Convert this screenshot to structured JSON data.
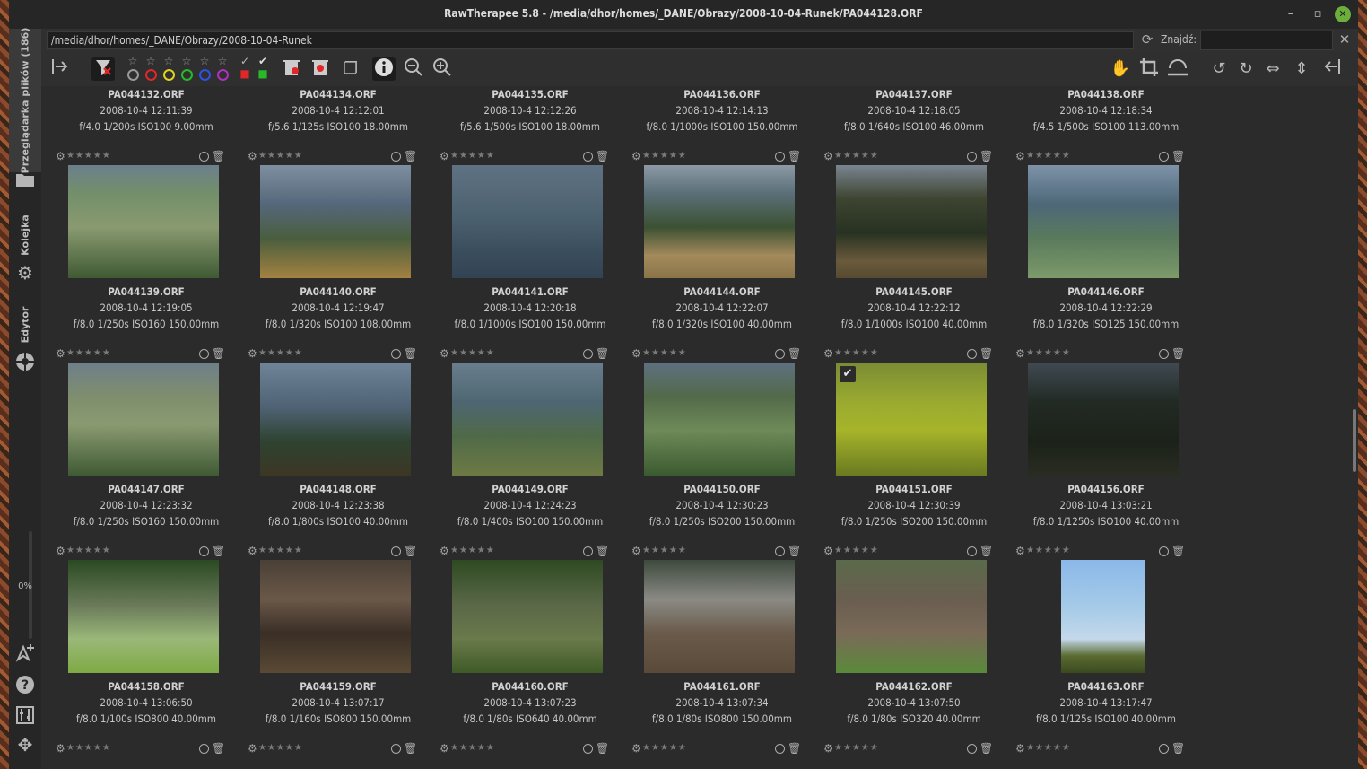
{
  "window": {
    "title": "RawTherapee 5.8 - /media/dhor/homes/_DANE/Obrazy/2008-10-04-Runek/PA044128.ORF"
  },
  "sidebar": {
    "tabs": [
      {
        "label": "Przeglądarka plików (186)"
      },
      {
        "label": "Kolejka"
      },
      {
        "label": "Edytor"
      }
    ],
    "progress": "0%"
  },
  "pathbar": {
    "path": "/media/dhor/homes/_DANE/Obrazy/2008-10-04-Runek",
    "find_label": "Znajdź:",
    "find_value": ""
  },
  "toolbar": {
    "zoom_hint": "",
    "colors": {
      "red": "#e02828",
      "yellow": "#e0d020",
      "green": "#28b828",
      "blue": "#3050e0",
      "purple": "#b030c0"
    }
  },
  "rows": [
    {
      "items": [
        {
          "name": "PA044132.ORF",
          "date": "2008-10-4 12:11:39",
          "exif": "f/4.0 1/200s ISO100 9.00mm"
        },
        {
          "name": "PA044134.ORF",
          "date": "2008-10-4 12:12:01",
          "exif": "f/5.6 1/125s ISO100 18.00mm"
        },
        {
          "name": "PA044135.ORF",
          "date": "2008-10-4 12:12:26",
          "exif": "f/5.6 1/500s ISO100 18.00mm"
        },
        {
          "name": "PA044136.ORF",
          "date": "2008-10-4 12:14:13",
          "exif": "f/8.0 1/1000s ISO100 150.00mm"
        },
        {
          "name": "PA044137.ORF",
          "date": "2008-10-4 12:18:05",
          "exif": "f/8.0 1/640s ISO100 46.00mm"
        },
        {
          "name": "PA044138.ORF",
          "date": "2008-10-4 12:18:34",
          "exif": "f/4.5 1/500s ISO100 113.00mm"
        }
      ]
    },
    {
      "items": [
        {
          "name": "PA044139.ORF",
          "date": "2008-10-4 12:19:05",
          "exif": "f/8.0 1/250s ISO160 150.00mm"
        },
        {
          "name": "PA044140.ORF",
          "date": "2008-10-4 12:19:47",
          "exif": "f/8.0 1/320s ISO100 108.00mm"
        },
        {
          "name": "PA044141.ORF",
          "date": "2008-10-4 12:20:18",
          "exif": "f/8.0 1/1000s ISO100 150.00mm"
        },
        {
          "name": "PA044144.ORF",
          "date": "2008-10-4 12:22:07",
          "exif": "f/8.0 1/320s ISO100 40.00mm"
        },
        {
          "name": "PA044145.ORF",
          "date": "2008-10-4 12:22:12",
          "exif": "f/8.0 1/1000s ISO100 40.00mm"
        },
        {
          "name": "PA044146.ORF",
          "date": "2008-10-4 12:22:29",
          "exif": "f/8.0 1/320s ISO125 150.00mm"
        }
      ]
    },
    {
      "items": [
        {
          "name": "PA044147.ORF",
          "date": "2008-10-4 12:23:32",
          "exif": "f/8.0 1/250s ISO160 150.00mm"
        },
        {
          "name": "PA044148.ORF",
          "date": "2008-10-4 12:23:38",
          "exif": "f/8.0 1/800s ISO100 40.00mm"
        },
        {
          "name": "PA044149.ORF",
          "date": "2008-10-4 12:24:23",
          "exif": "f/8.0 1/400s ISO100 150.00mm"
        },
        {
          "name": "PA044150.ORF",
          "date": "2008-10-4 12:30:23",
          "exif": "f/8.0 1/250s ISO200 150.00mm"
        },
        {
          "name": "PA044151.ORF",
          "date": "2008-10-4 12:30:39",
          "exif": "f/8.0 1/250s ISO200 150.00mm"
        },
        {
          "name": "PA044156.ORF",
          "date": "2008-10-4 13:03:21",
          "exif": "f/8.0 1/1250s ISO100 40.00mm"
        }
      ]
    },
    {
      "items": [
        {
          "name": "PA044158.ORF",
          "date": "2008-10-4 13:06:50",
          "exif": "f/8.0 1/100s ISO800 40.00mm"
        },
        {
          "name": "PA044159.ORF",
          "date": "2008-10-4 13:07:17",
          "exif": "f/8.0 1/160s ISO800 150.00mm"
        },
        {
          "name": "PA044160.ORF",
          "date": "2008-10-4 13:07:23",
          "exif": "f/8.0 1/80s ISO640 40.00mm"
        },
        {
          "name": "PA044161.ORF",
          "date": "2008-10-4 13:07:34",
          "exif": "f/8.0 1/80s ISO800 150.00mm"
        },
        {
          "name": "PA044162.ORF",
          "date": "2008-10-4 13:07:50",
          "exif": "f/8.0 1/80s ISO320 40.00mm"
        },
        {
          "name": "PA044163.ORF",
          "date": "2008-10-4 13:17:47",
          "exif": "f/8.0 1/125s ISO100 40.00mm"
        }
      ]
    }
  ]
}
